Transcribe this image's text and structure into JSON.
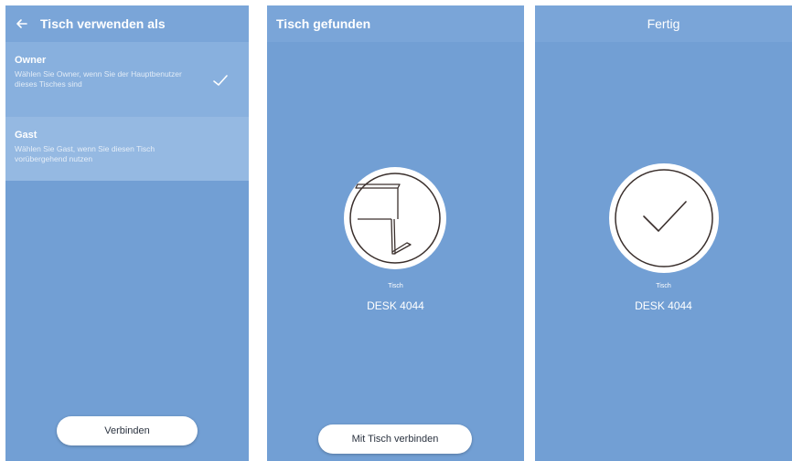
{
  "screen1": {
    "title": "Tisch verwenden als",
    "options": [
      {
        "title": "Owner",
        "description": "Wählen Sie Owner, wenn Sie der Hauptbenutzer dieses Tisches sind",
        "selected": true
      },
      {
        "title": "Gast",
        "description": "Wählen Sie Gast, wenn Sie diesen Tisch vorübergehend nutzen",
        "selected": false
      }
    ],
    "button_label": "Verbinden"
  },
  "screen2": {
    "title": "Tisch gefunden",
    "device_caption": "Tisch",
    "device_name": "DESK 4044",
    "button_label": "Mit Tisch verbinden",
    "icon": "desk-icon"
  },
  "screen3": {
    "title": "Fertig",
    "device_caption": "Tisch",
    "device_name": "DESK 4044",
    "icon": "checkmark-icon"
  },
  "colors": {
    "background": "#729fd4",
    "header": "#7aa5d8",
    "selected_option": "#88b0de",
    "option": "#95b9e2",
    "button": "#ffffff"
  }
}
